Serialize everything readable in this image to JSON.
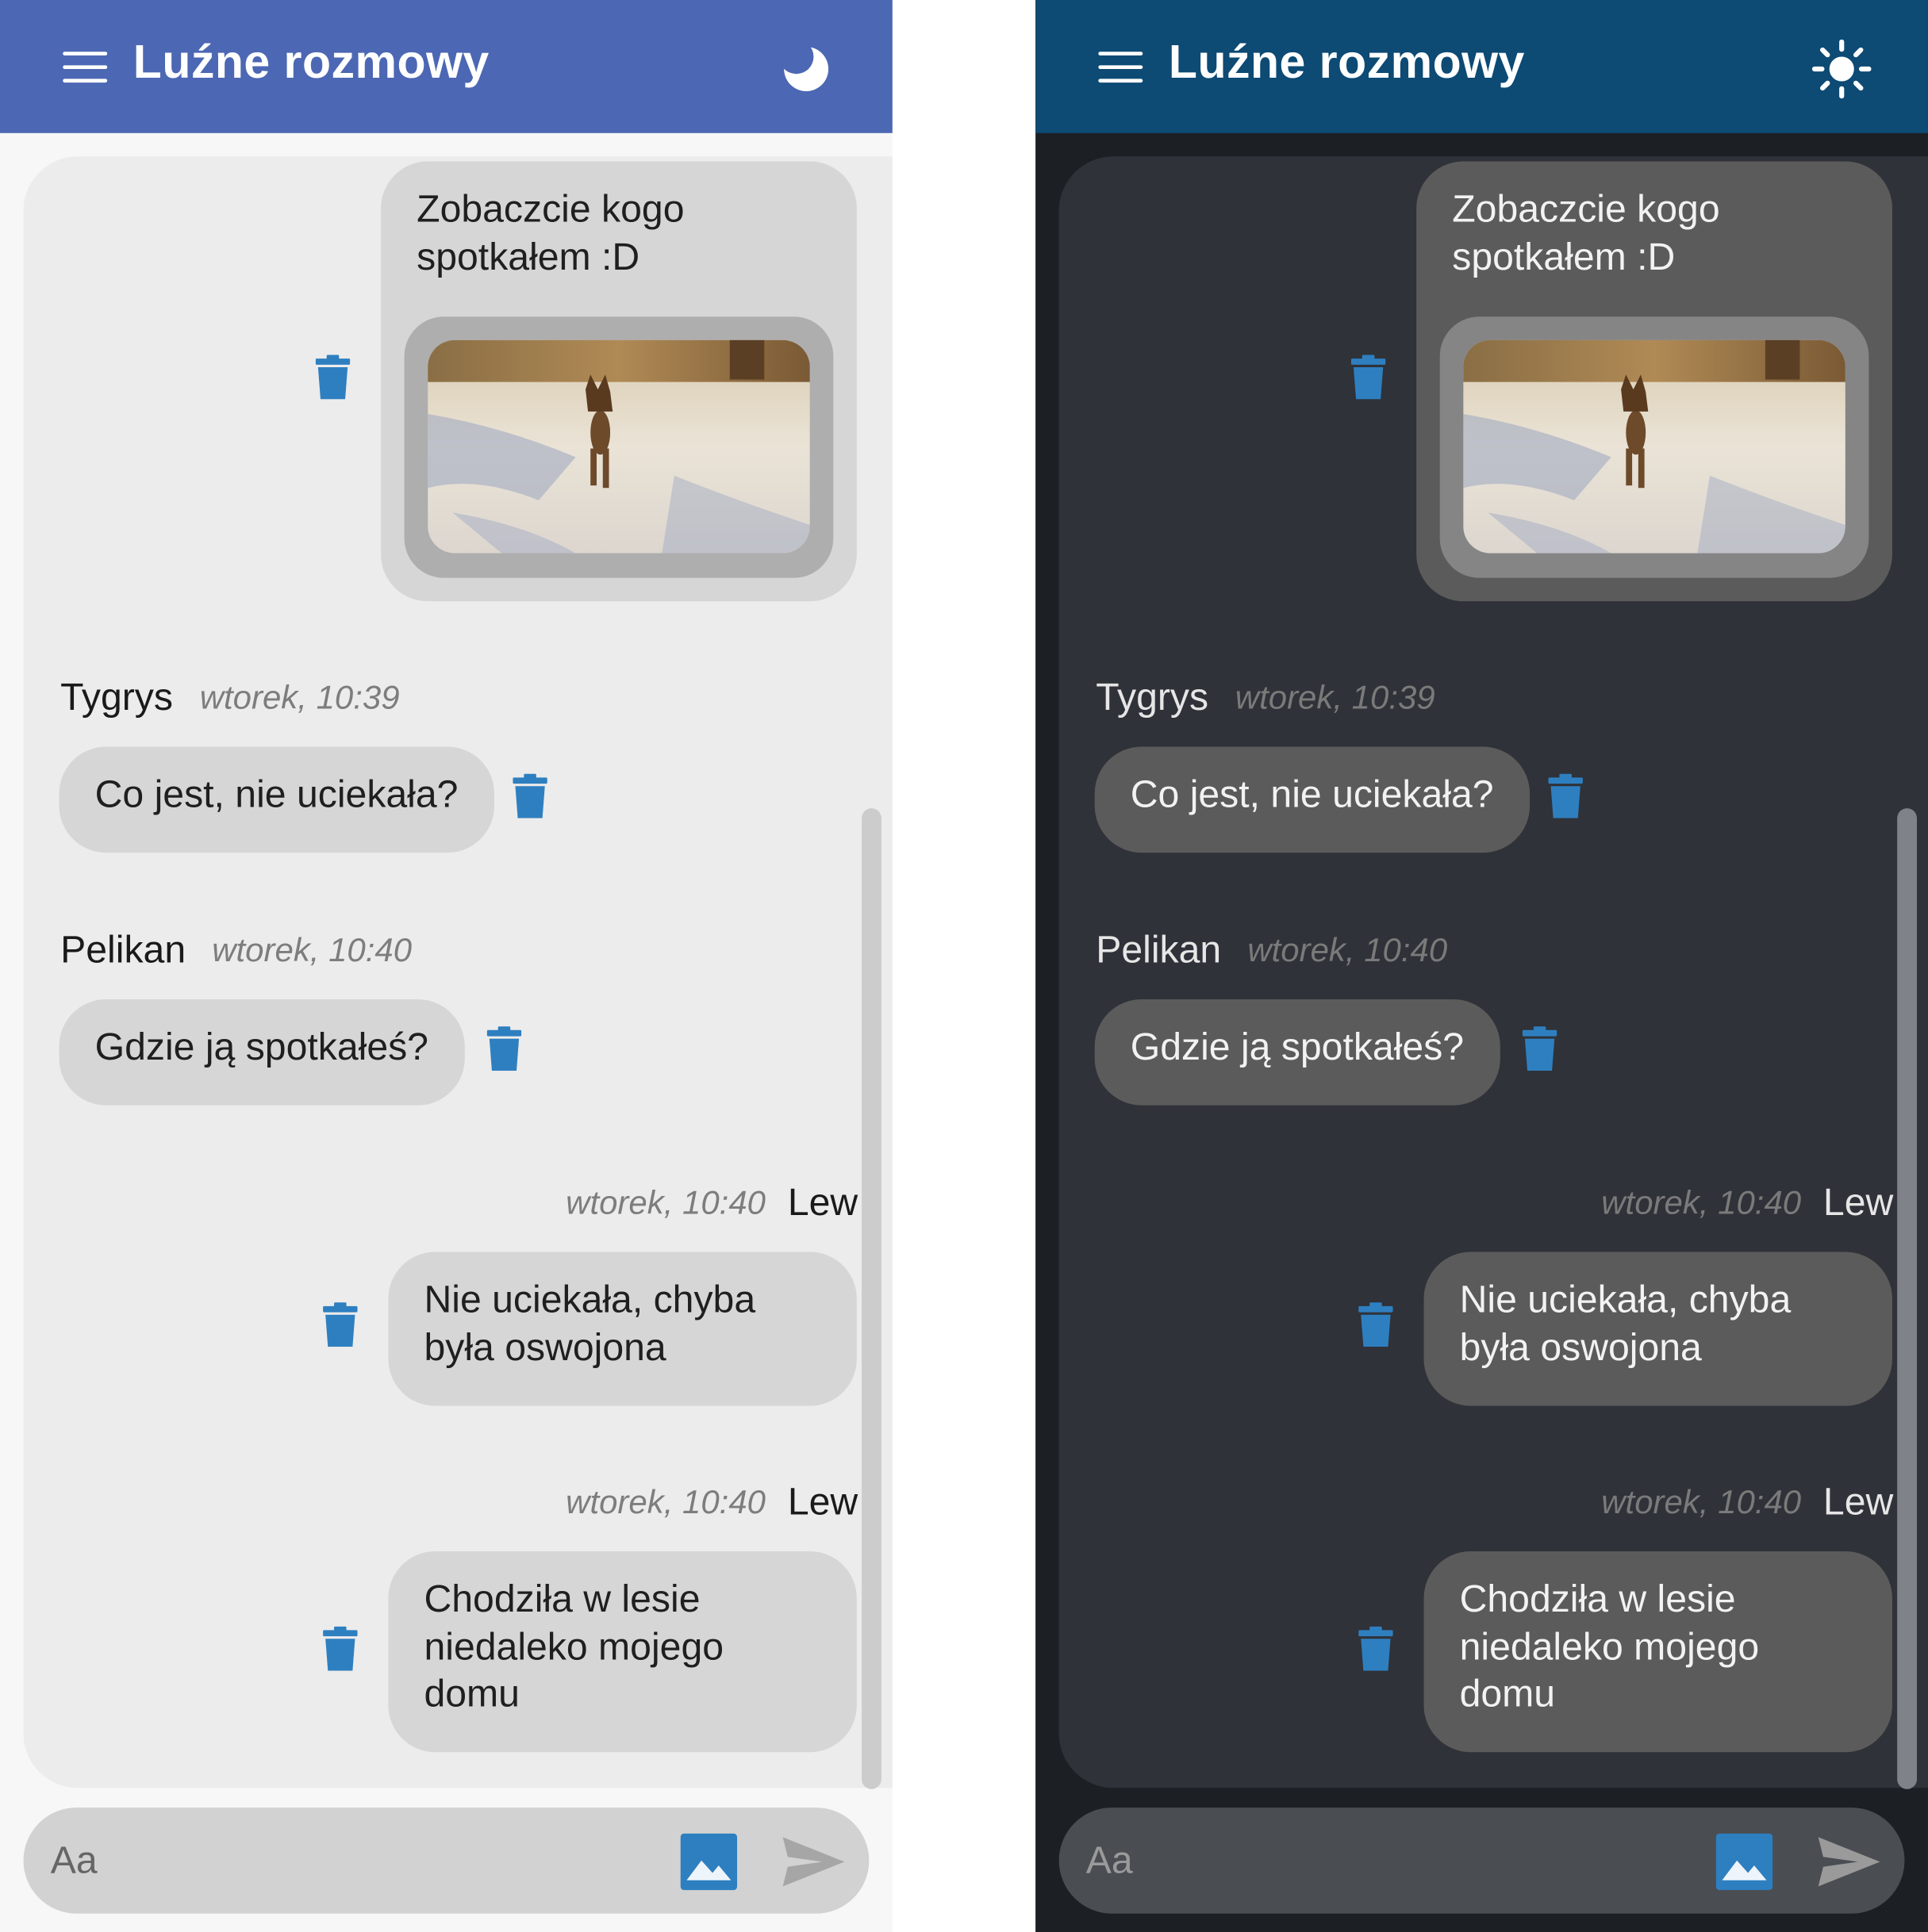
{
  "app": {
    "title": "Luźne rozmowy"
  },
  "themes": {
    "light": {
      "toggle_icon": "moon-icon",
      "appbar_color": "#4c67b3"
    },
    "dark": {
      "toggle_icon": "sun-icon",
      "appbar_color": "#0d4a74"
    }
  },
  "accent_color": "#2e7fc0",
  "messages": [
    {
      "outgoing": true,
      "author": "",
      "time": "",
      "lines": [
        "Zobaczcie kogo",
        "spotkałem :D"
      ],
      "has_image": true,
      "image_icon": "dog-in-snow-photo"
    },
    {
      "outgoing": false,
      "author": "Tygrys",
      "time": "wtorek, 10:39",
      "text": "Co jest, nie uciekała?"
    },
    {
      "outgoing": false,
      "author": "Pelikan",
      "time": "wtorek, 10:40",
      "text": "Gdzie ją spotkałeś?"
    },
    {
      "outgoing": true,
      "author": "Lew",
      "time": "wtorek, 10:40",
      "lines": [
        "Nie uciekała, chyba",
        "była oswojona"
      ]
    },
    {
      "outgoing": true,
      "author": "Lew",
      "time": "wtorek, 10:40",
      "lines": [
        "Chodziła w lesie",
        "niedaleko mojego",
        "domu"
      ]
    }
  ],
  "composer": {
    "placeholder": "Aa",
    "image_button_icon": "image-icon",
    "send_button_icon": "send-icon"
  }
}
